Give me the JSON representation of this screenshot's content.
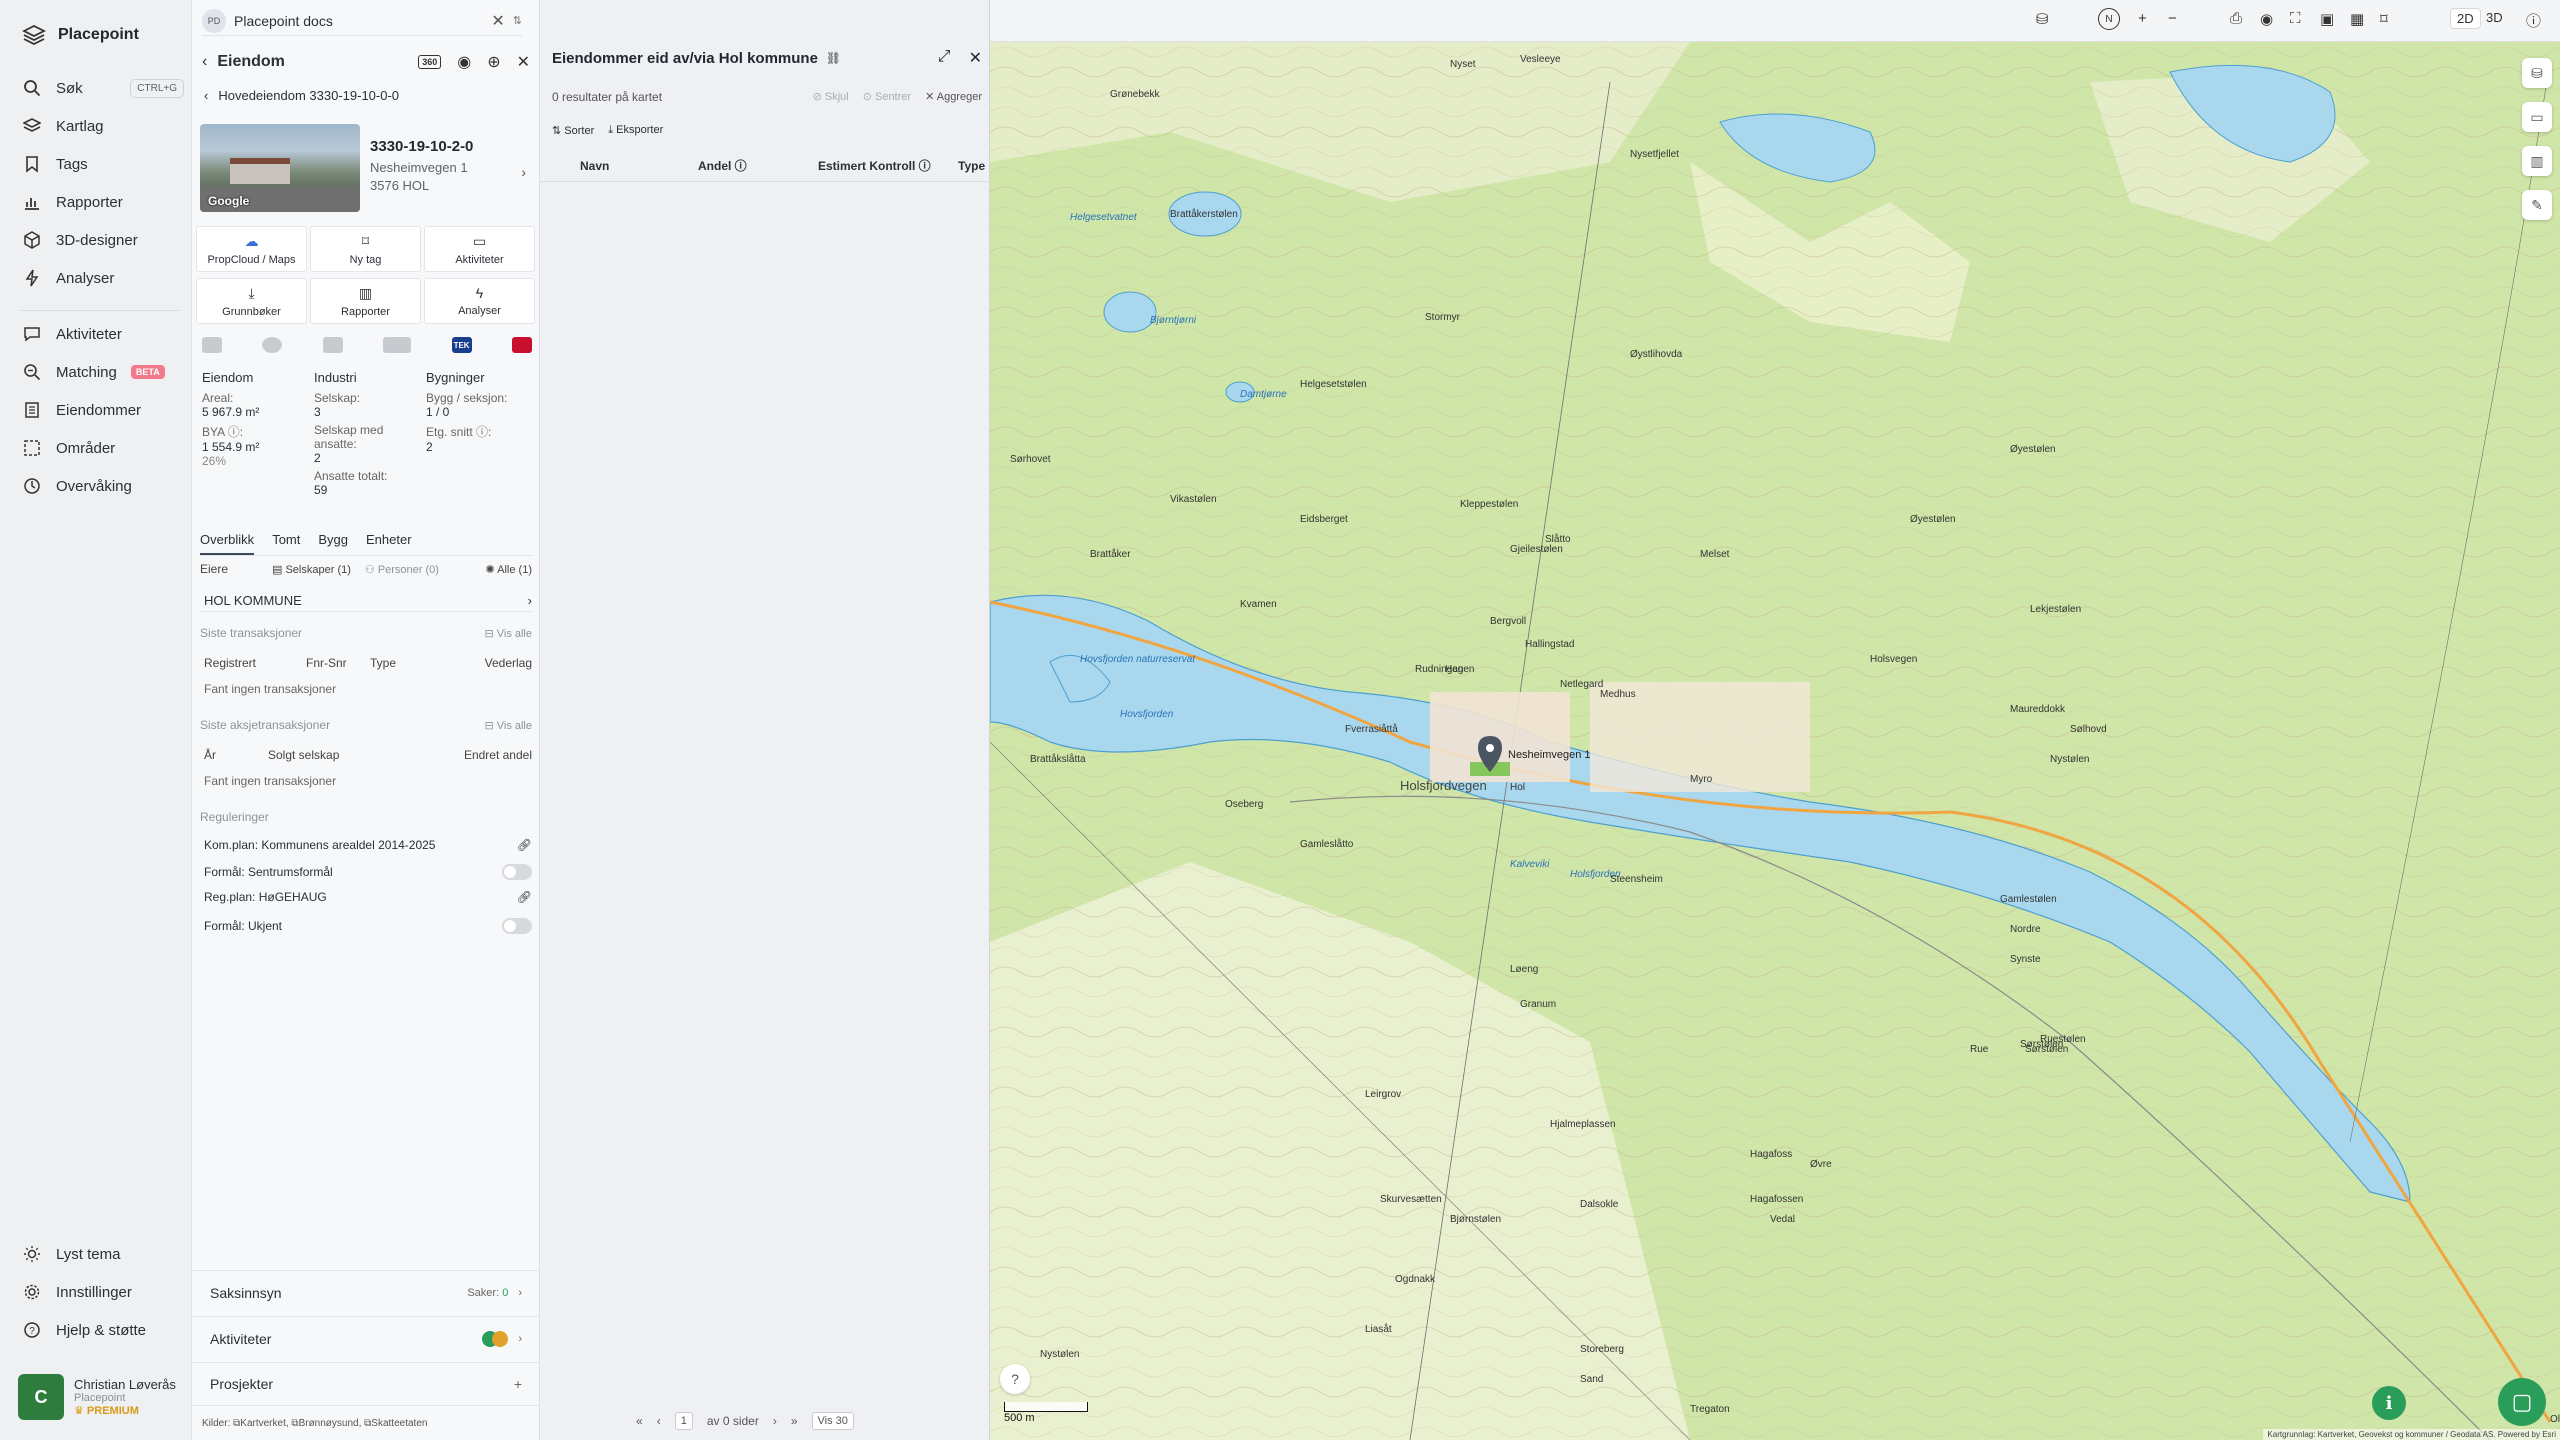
{
  "nav": {
    "brand": "Placepoint",
    "items": [
      {
        "label": "Søk",
        "icon": "search-icon",
        "shortcut": "CTRL+G"
      },
      {
        "label": "Kartlag",
        "icon": "layers-icon"
      },
      {
        "label": "Tags",
        "icon": "bookmark-icon"
      },
      {
        "label": "Rapporter",
        "icon": "chart-icon"
      },
      {
        "label": "3D-designer",
        "icon": "cube-icon"
      },
      {
        "label": "Analyser",
        "icon": "bolt-icon"
      },
      {
        "label": "Aktiviteter",
        "icon": "chat-icon"
      },
      {
        "label": "Matching",
        "icon": "match-icon",
        "badge": "BETA"
      },
      {
        "label": "Eiendommer",
        "icon": "building-icon"
      },
      {
        "label": "Områder",
        "icon": "area-icon"
      },
      {
        "label": "Overvåking",
        "icon": "monitor-icon"
      }
    ],
    "bottom": [
      {
        "label": "Lyst tema",
        "icon": "sun-icon"
      },
      {
        "label": "Innstillinger",
        "icon": "gear-icon"
      },
      {
        "label": "Hjelp & støtte",
        "icon": "help-icon"
      }
    ],
    "user": {
      "initial": "C",
      "name": "Christian Løverås",
      "org": "Placepoint",
      "plan": "PREMIUM"
    }
  },
  "docs": {
    "badge": "PD",
    "label": "Placepoint docs"
  },
  "property": {
    "title": "Eiendom",
    "badge360": "360",
    "breadcrumb": "Hovedeiendom 3330-19-10-0-0",
    "id": "3330-19-10-2-0",
    "street": "Nesheimvegen 1",
    "city": "3576 HOL",
    "thumb_label": "Google",
    "tiles": [
      {
        "label": "PropCloud / Maps",
        "icon": "propcloud-icon"
      },
      {
        "label": "Ny tag",
        "icon": "tag-icon"
      },
      {
        "label": "Aktiviteter",
        "icon": "chat-icon"
      },
      {
        "label": "Grunnbøker",
        "icon": "download-icon"
      },
      {
        "label": "Rapporter",
        "icon": "chart-icon"
      },
      {
        "label": "Analyser",
        "icon": "bolt-icon"
      }
    ],
    "tek_label": "TEK",
    "stats": {
      "eiendom": {
        "heading": "Eiendom",
        "areal_label": "Areal:",
        "areal": "5 967.9 m²",
        "bya_label": "BYA ⓘ:",
        "bya": "1 554.9 m²",
        "bya_pct": "26%"
      },
      "industri": {
        "heading": "Industri",
        "selskap_label": "Selskap:",
        "selskap": "3",
        "ansatte_label": "Selskap med ansatte:",
        "ansatte": "2",
        "totalt_label": "Ansatte totalt:",
        "totalt": "59"
      },
      "bygninger": {
        "heading": "Bygninger",
        "seksjon_label": "Bygg / seksjon:",
        "seksjon": "1 / 0",
        "etg_label": "Etg. snitt ⓘ:",
        "etg": "2"
      }
    },
    "tabs": [
      "Overblikk",
      "Tomt",
      "Bygg",
      "Enheter"
    ],
    "owners": {
      "label": "Eiere",
      "companies": "Selskaper (1)",
      "persons": "Personer (0)",
      "all": "Alle (1)",
      "owner": "HOL KOMMUNE"
    },
    "transactions": {
      "label": "Siste transaksjoner",
      "see_all": "Vis alle",
      "cols": [
        "Registrert",
        "Fnr-Snr",
        "Type",
        "Vederlag"
      ],
      "empty": "Fant ingen transaksjoner"
    },
    "share_tx": {
      "label": "Siste aksjetransaksjoner",
      "see_all": "Vis alle",
      "cols": [
        "År",
        "Solgt selskap",
        "Endret andel"
      ],
      "empty": "Fant ingen transaksjoner"
    },
    "regulations": {
      "label": "Reguleringer",
      "items": [
        "Kom.plan: Kommunens arealdel 2014-2025",
        "Formål: Sentrumsformål",
        "Reg.plan: HøGEHAUG",
        "Formål: Ukjent"
      ]
    },
    "saksinnsyn": {
      "label": "Saksinnsyn",
      "count_label": "Saker:",
      "count": "0"
    },
    "aktiviteter": {
      "label": "Aktiviteter"
    },
    "prosjekter": {
      "label": "Prosjekter"
    },
    "sources": {
      "label": "Kilder:",
      "items": [
        "Kartverket,",
        "Brønnøysund,",
        "Skatteetaten"
      ]
    }
  },
  "list": {
    "title": "Eiendommer eid av/via Hol kommune",
    "result": "0 resultater på kartet",
    "tools": [
      "Skjul",
      "Sentrer",
      "Aggreger"
    ],
    "toolbar": [
      "Sorter",
      "Eksporter"
    ],
    "columns": [
      "Navn",
      "Andel ⓘ",
      "Estimert Kontroll ⓘ",
      "Type"
    ],
    "pager": {
      "page": "1",
      "of": "av 0 sider",
      "per_page": "Vis 30"
    }
  },
  "map": {
    "mode_2d": "2D",
    "mode_3d": "3D",
    "scale": "500 m",
    "marker_label": "Nesheimvegen 1",
    "attribution": "Kartgrunnlag: Kartverket, Geovekst og kommuner / Geodata AS. Powered by Esri",
    "places": [
      "Vesleeye",
      "Nyset",
      "Nysetfjellet",
      "Grønebekk",
      "Brattåkerstølen",
      "Helgesetvatnet",
      "Stormyr",
      "Bjørntjørni",
      "Damtjørne",
      "Helgesetstølen",
      "Øystlihovda",
      "Sørhovet",
      "Vikastølen",
      "Eidsberget",
      "Kleppestølen",
      "Gjeilestølen",
      "Melset",
      "Øyestølen",
      "Brattåker",
      "Kvamen",
      "Slåtto",
      "Bergvoll",
      "Hallingstad",
      "Hovsfjorden naturreservat",
      "Hovsfjorden",
      "Fverrasiåttå",
      "Rudningen",
      "Hagen",
      "Netlegard",
      "Medhus",
      "Brattåkslåtta",
      "Holsfjordvegen",
      "Hol",
      "Myro",
      "Oseberg",
      "Gamleslåtto",
      "Kalveviki",
      "Holsfjorden",
      "Steensheim",
      "Løeng",
      "Granum",
      "Leirgrov",
      "Hjalmeplassen",
      "Skurvesætten",
      "Dalsokle",
      "Bjørnstølen",
      "Ogdnakk",
      "Nystølen",
      "Liasåt",
      "Storeberg",
      "Hagafoss",
      "Hagafossen",
      "Vedal",
      "Sand",
      "Tregaton",
      "Olberg",
      "Gamlestølen",
      "Nordre",
      "Synste",
      "Ruestølen",
      "Øvre",
      "Lekjestølen",
      "Maureddokk",
      "Sølhovd",
      "Nystølen",
      "Holsvegen",
      "Sørstølen",
      "Rue",
      "Sørstølen",
      "Øyestølen"
    ]
  }
}
